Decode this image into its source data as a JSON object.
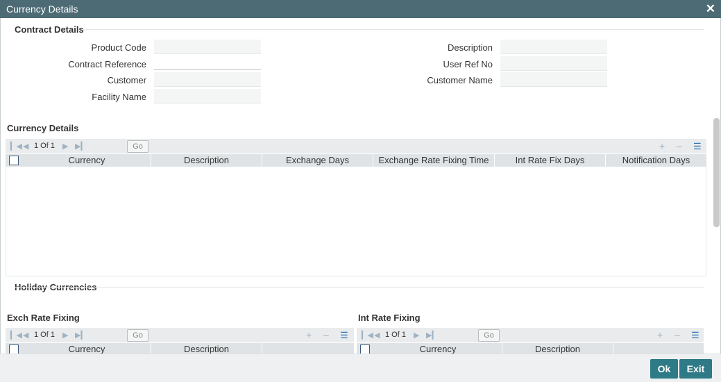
{
  "window": {
    "title": "Currency Details",
    "close_glyph": "✕"
  },
  "contract": {
    "heading": "Contract Details",
    "product_code_label": "Product Code",
    "contract_reference_label": "Contract Reference",
    "customer_label": "Customer",
    "facility_name_label": "Facility Name",
    "description_label": "Description",
    "user_ref_no_label": "User Ref No",
    "customer_name_label": "Customer Name",
    "product_code": "",
    "contract_reference": "",
    "customer": "",
    "facility_name": "",
    "description": "",
    "user_ref_no": "",
    "customer_name": ""
  },
  "currency_grid": {
    "heading": "Currency Details",
    "page_text": "1 Of 1",
    "go_label": "Go",
    "columns": [
      "Currency",
      "Description",
      "Exchange Days",
      "Exchange Rate Fixing Time",
      "Int Rate Fix Days",
      "Notification Days"
    ]
  },
  "holiday": {
    "heading": "Holiday Currencies",
    "exch": {
      "heading": "Exch Rate Fixing",
      "page_text": "1 Of 1",
      "go_label": "Go",
      "columns": [
        "Currency",
        "Description"
      ]
    },
    "int": {
      "heading": "Int Rate Fixing",
      "page_text": "1 Of 1",
      "go_label": "Go",
      "columns": [
        "Currency",
        "Description"
      ]
    }
  },
  "icons": {
    "first": "first-page-icon",
    "prev": "prev-page-icon",
    "next": "next-page-icon",
    "last": "last-page-icon",
    "add": "add-row-icon",
    "delete": "delete-row-icon",
    "view": "single-view-icon"
  },
  "footer": {
    "ok_label": "Ok",
    "exit_label": "Exit"
  },
  "colors": {
    "titlebar": "#4d6b75",
    "button": "#2e7a86",
    "grid_header": "#dfe3e5"
  }
}
